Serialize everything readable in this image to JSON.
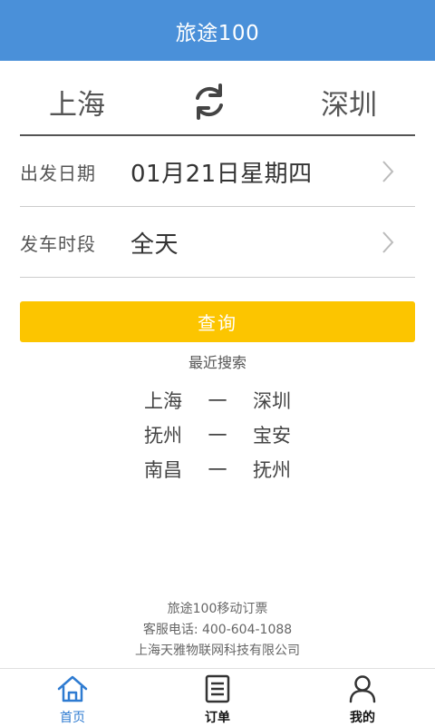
{
  "app_bar": {
    "title": "旅途100"
  },
  "route": {
    "from": "上海",
    "to": "深圳",
    "swap_icon": "swap-refresh-icon"
  },
  "form": {
    "date_label": "出发日期",
    "date_value": "01月21日星期四",
    "period_label": "发车时段",
    "period_value": "全天"
  },
  "query_button": {
    "label": "查询"
  },
  "recent": {
    "title": "最近搜索",
    "separator": "一",
    "items": [
      {
        "from": "上海",
        "to": "深圳"
      },
      {
        "from": "抚州",
        "to": "宝安"
      },
      {
        "from": "南昌",
        "to": "抚州"
      }
    ]
  },
  "footer": {
    "line1": "旅途100移动订票",
    "line2": "客服电话: 400-604-1088",
    "line3": "上海天雅物联网科技有限公司"
  },
  "tabs": [
    {
      "label": "首页",
      "icon": "home-icon",
      "active": true
    },
    {
      "label": "订单",
      "icon": "orders-icon",
      "active": false
    },
    {
      "label": "我的",
      "icon": "profile-icon",
      "active": false
    }
  ],
  "colors": {
    "primary": "#4a90d9",
    "button": "#fcc500",
    "active_tab": "#2e7bd1"
  }
}
